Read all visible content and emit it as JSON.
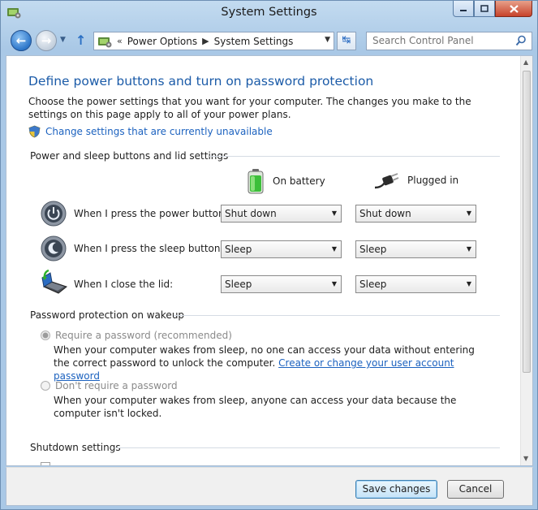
{
  "window": {
    "title": "System Settings"
  },
  "address_bar": {
    "overflow": "«",
    "crumbs": [
      "Power Options",
      "System Settings"
    ],
    "search_placeholder": "Search Control Panel"
  },
  "page": {
    "heading": "Define power buttons and turn on password protection",
    "description": "Choose the power settings that you want for your computer. The changes you make to the settings on this page apply to all of your power plans.",
    "unavailable_link": "Change settings that are currently unavailable"
  },
  "power_section": {
    "title": "Power and sleep buttons and lid settings",
    "columns": [
      "On battery",
      "Plugged in"
    ],
    "rows": [
      {
        "label": "When I press the power button:",
        "battery": "Shut down",
        "plugged": "Shut down"
      },
      {
        "label": "When I press the sleep button:",
        "battery": "Sleep",
        "plugged": "Sleep"
      },
      {
        "label": "When I close the lid:",
        "battery": "Sleep",
        "plugged": "Sleep"
      }
    ]
  },
  "password_section": {
    "title": "Password protection on wakeup",
    "require": {
      "label": "Require a password (recommended)",
      "desc": "When your computer wakes from sleep, no one can access your data without entering the correct password to unlock the computer.",
      "link": "Create or change your user account password",
      "selected": true
    },
    "no_require": {
      "label": "Don't require a password",
      "desc": "When your computer wakes from sleep, anyone can access your data because the computer isn't locked.",
      "selected": false
    }
  },
  "shutdown_section": {
    "title": "Shutdown settings"
  },
  "footer": {
    "save": "Save changes",
    "cancel": "Cancel"
  },
  "colors": {
    "heading": "#1b5ba8",
    "link": "#1c62bf",
    "chrome": "#a9c8e6"
  }
}
